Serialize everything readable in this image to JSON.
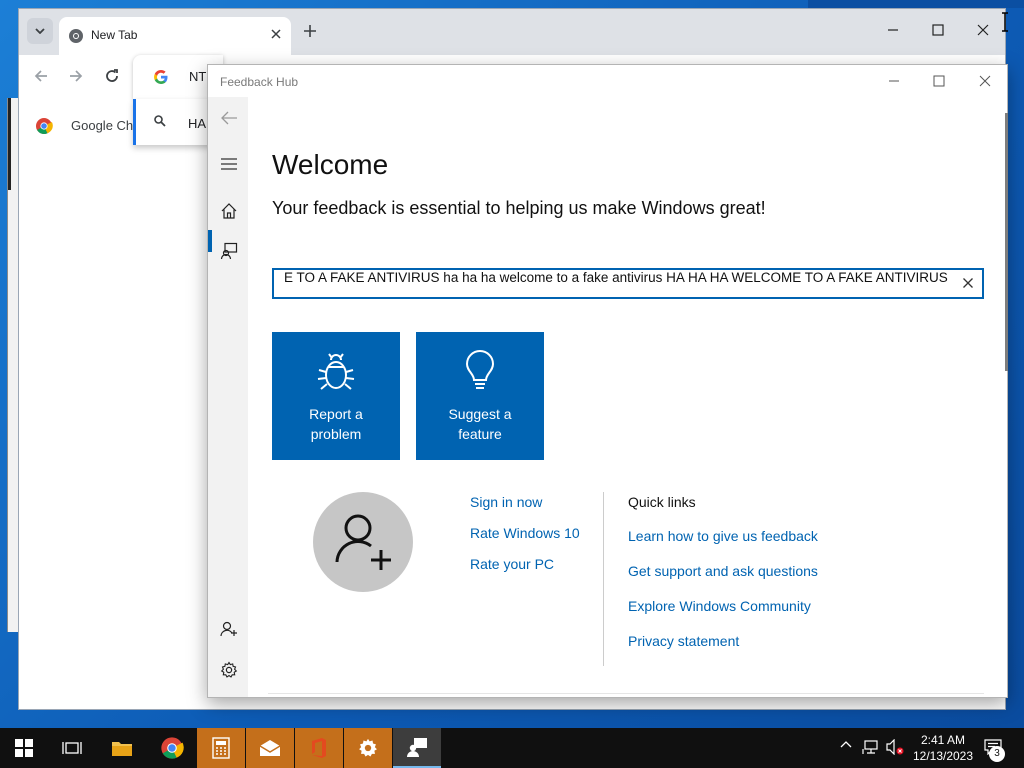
{
  "chrome": {
    "tab_title": "New Tab",
    "omnibox_text": "NT",
    "suggestion_text": "HA",
    "bookmark_label": "Google Ch"
  },
  "feedback_hub": {
    "window_title": "Feedback Hub",
    "welcome_heading": "Welcome",
    "subtitle": "Your feedback is essential to helping us make Windows great!",
    "search_value": "E TO A FAKE ANTIVIRUS ha ha ha welcome to a fake antivirus HA HA HA WELCOME TO A FAKE ANTIVIRUS",
    "tiles": [
      {
        "label": "Report a\nproblem",
        "icon": "bug-icon"
      },
      {
        "label": "Suggest a\nfeature",
        "icon": "lightbulb-icon"
      }
    ],
    "account_links": [
      "Sign in now",
      "Rate Windows 10",
      "Rate your PC"
    ],
    "quick_links_title": "Quick links",
    "quick_links": [
      "Learn how to give us feedback",
      "Get support and ask questions",
      "Explore Windows Community",
      "Privacy statement"
    ],
    "sidebar_icons": [
      "back-arrow-icon",
      "hamburger-icon",
      "home-icon",
      "feedback-icon",
      "add-account-icon",
      "settings-icon"
    ],
    "accent_color": "#0063b1"
  },
  "taskbar": {
    "time": "2:41 AM",
    "date": "12/13/2023",
    "notification_count": "3",
    "apps": [
      "start-icon",
      "task-view-icon",
      "file-explorer-icon",
      "chrome-icon",
      "calculator-icon",
      "mail-icon",
      "office-icon",
      "settings-icon",
      "feedback-hub-icon"
    ]
  }
}
